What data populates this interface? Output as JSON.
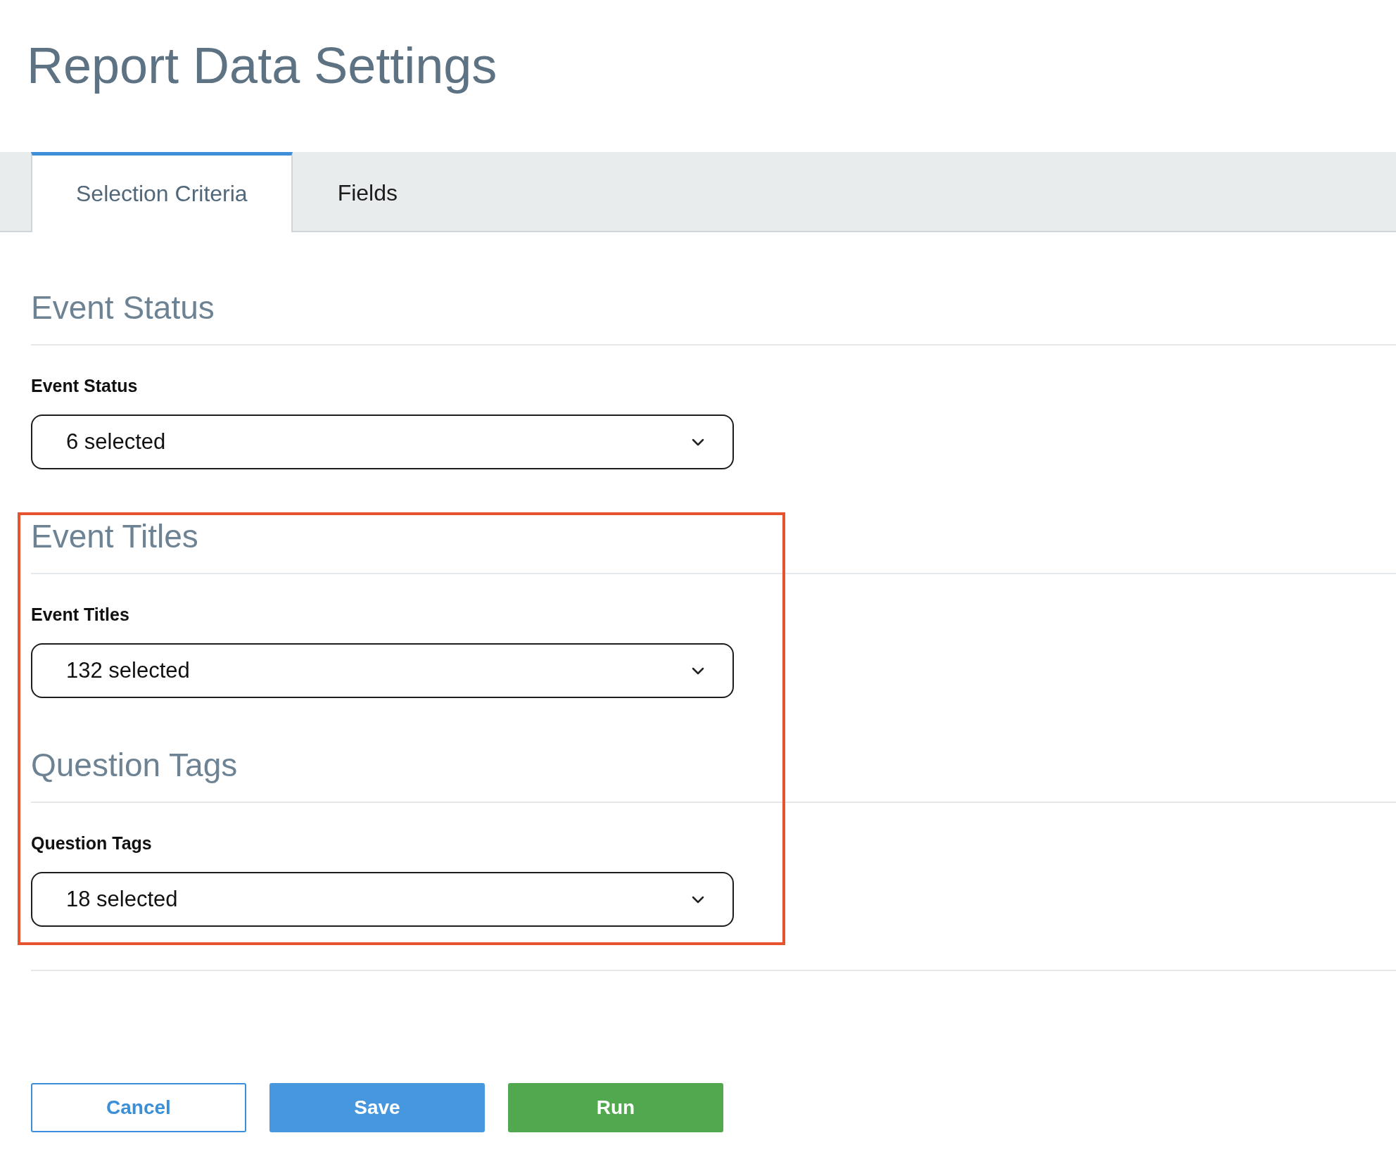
{
  "page_title": "Report Data Settings",
  "tabs": [
    {
      "label": "Selection Criteria",
      "selected": true
    },
    {
      "label": "Fields",
      "selected": false
    }
  ],
  "sections": [
    {
      "heading": "Event Status",
      "label": "Event Status",
      "value": "6 selected",
      "highlighted": false
    },
    {
      "heading": "Event Titles",
      "label": "Event Titles",
      "value": "132 selected",
      "highlighted": true
    },
    {
      "heading": "Question Tags",
      "label": "Question Tags",
      "value": "18 selected",
      "highlighted": true
    }
  ],
  "buttons": [
    {
      "label": "Cancel",
      "kind": "outline"
    },
    {
      "label": "Save",
      "kind": "primary"
    },
    {
      "label": "Run",
      "kind": "success"
    }
  ]
}
